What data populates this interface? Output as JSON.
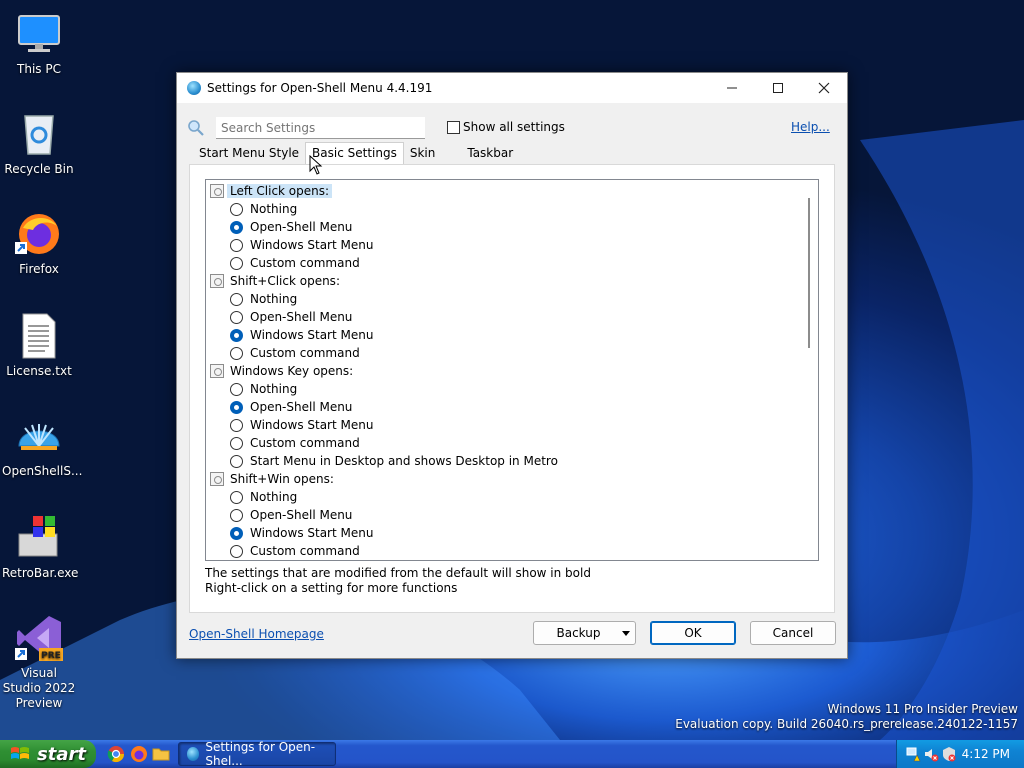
{
  "desktop": {
    "icons": [
      {
        "label": "This PC",
        "icon": "monitor-icon"
      },
      {
        "label": "Recycle Bin",
        "icon": "recycle-bin-icon"
      },
      {
        "label": "Firefox",
        "icon": "firefox-icon"
      },
      {
        "label": "License.txt",
        "icon": "text-file-icon"
      },
      {
        "label": "OpenShellS...",
        "icon": "shell-icon"
      },
      {
        "label": "RetroBar.exe",
        "icon": "retrobar-icon"
      },
      {
        "label": "Visual Studio 2022 Preview",
        "icon": "visual-studio-icon",
        "badge": "PRE"
      }
    ],
    "watermark_line1": "Windows 11 Pro Insider Preview",
    "watermark_line2": "Evaluation copy. Build 26040.rs_prerelease.240122-1157"
  },
  "dialog": {
    "title": "Settings for Open-Shell Menu 4.4.191",
    "search_placeholder": "Search Settings",
    "show_all_label": "Show all settings",
    "help_label": "Help...",
    "tabs": [
      "Start Menu Style",
      "Basic Settings",
      "Skin",
      "Taskbar"
    ],
    "active_tab": "Basic Settings",
    "groups": [
      {
        "label": "Left Click opens:",
        "options": [
          "Nothing",
          "Open-Shell Menu",
          "Windows Start Menu",
          "Custom command"
        ],
        "selected": 1
      },
      {
        "label": "Shift+Click opens:",
        "options": [
          "Nothing",
          "Open-Shell Menu",
          "Windows Start Menu",
          "Custom command"
        ],
        "selected": 2
      },
      {
        "label": "Windows Key opens:",
        "options": [
          "Nothing",
          "Open-Shell Menu",
          "Windows Start Menu",
          "Custom command",
          "Start Menu in Desktop and shows Desktop in Metro"
        ],
        "selected": 1
      },
      {
        "label": "Shift+Win opens:",
        "options": [
          "Nothing",
          "Open-Shell Menu",
          "Windows Start Menu",
          "Custom command"
        ],
        "selected": 2
      }
    ],
    "hint_line1": "The settings that are modified from the default will show in bold",
    "hint_line2": "Right-click on a setting for more functions",
    "homepage_label": "Open-Shell Homepage",
    "backup_label": "Backup",
    "ok_label": "OK",
    "cancel_label": "Cancel"
  },
  "taskbar": {
    "start_label": "start",
    "task_label": "Settings for Open-Shel...",
    "clock": "4:12 PM"
  }
}
